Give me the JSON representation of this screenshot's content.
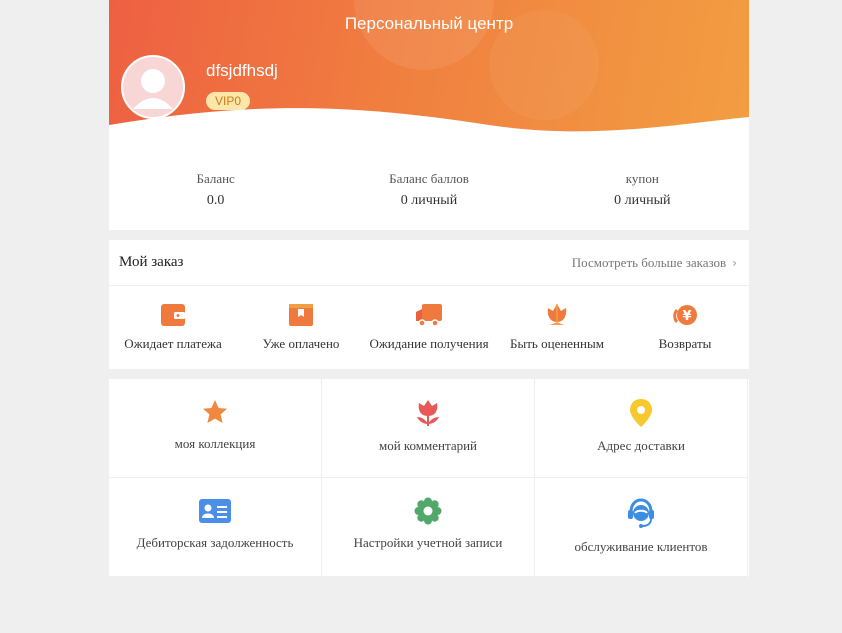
{
  "header": {
    "title": "Персональный центр",
    "username": "dfsjdfhsdj",
    "vip": "VIP0"
  },
  "balance": [
    {
      "label": "Баланс",
      "value": "0.0"
    },
    {
      "label": "Баланс баллов",
      "value": "0 личный"
    },
    {
      "label": "купон",
      "value": "0 личный"
    }
  ],
  "orders": {
    "title": "Мой заказ",
    "more": "Посмотреть больше заказов",
    "items": [
      {
        "label": "Ожидает платежа",
        "icon": "wallet-icon"
      },
      {
        "label": "Уже оплачено",
        "icon": "paid-box-icon"
      },
      {
        "label": "Ожидание получения",
        "icon": "delivery-truck-icon"
      },
      {
        "label": "Быть оцененным",
        "icon": "flower-icon"
      },
      {
        "label": "Возвраты",
        "icon": "refund-yen-icon"
      }
    ]
  },
  "grid": [
    {
      "label": "моя коллекция",
      "icon": "star-icon"
    },
    {
      "label": "мой комментарий",
      "icon": "tulip-icon"
    },
    {
      "label": "Адрес доставки",
      "icon": "location-pin-icon"
    },
    {
      "label": "Дебиторская задолженность",
      "icon": "id-card-icon"
    },
    {
      "label": "Настройки учетной записи",
      "icon": "settings-gear-icon"
    },
    {
      "label": "обслуживание клиентов",
      "icon": "customer-service-icon"
    }
  ],
  "colors": {
    "accent": "#f07a3e",
    "gradient_start": "#ee6042",
    "gradient_end": "#f29e42"
  }
}
